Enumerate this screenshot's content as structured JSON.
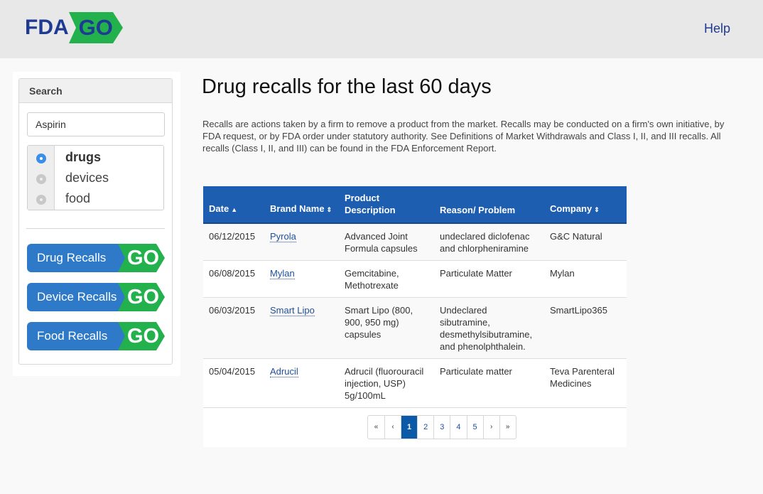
{
  "header": {
    "logo_fda": "FDA",
    "logo_go": "GO",
    "help_label": "Help"
  },
  "sidebar": {
    "panel_title": "Search",
    "search_value": "Aspirin",
    "categories": [
      {
        "label": "drugs",
        "checked": true
      },
      {
        "label": "devices",
        "checked": false
      },
      {
        "label": "food",
        "checked": false
      }
    ],
    "buttons": [
      {
        "label": "Drug Recalls",
        "go": "GO"
      },
      {
        "label": "Device Recalls",
        "go": "GO"
      },
      {
        "label": "Food Recalls",
        "go": "GO"
      }
    ]
  },
  "main": {
    "title": "Drug recalls for the last 60 days",
    "intro": "Recalls are actions taken by a firm to remove a product from the market. Recalls may be conducted on a firm's own initiative, by FDA request, or by FDA order under statutory authority. See Definitions of Market Withdrawals and Class I, II, and III recalls. All recalls (Class I, II, and III) can be found in the FDA Enforcement Report.",
    "table": {
      "columns": [
        {
          "label": "Date",
          "sort": "▲"
        },
        {
          "label": "Brand Name",
          "sort": "⇕"
        },
        {
          "label": "Product Description",
          "sort": ""
        },
        {
          "label": "Reason/ Problem",
          "sort": ""
        },
        {
          "label": "Company",
          "sort": "⇕"
        }
      ],
      "rows": [
        {
          "date": "06/12/2015",
          "brand": "Pyrola",
          "product": "Advanced Joint Formula capsules",
          "reason": "undeclared diclofenac and chlorpheniramine",
          "company": "G&C Natural"
        },
        {
          "date": "06/08/2015",
          "brand": "Mylan",
          "product": "Gemcitabine, Methotrexate",
          "reason": "Particulate Matter",
          "company": "Mylan"
        },
        {
          "date": "06/03/2015",
          "brand": "Smart Lipo",
          "product": "Smart Lipo (800, 900, 950 mg) capsules",
          "reason": "Undeclared sibutramine, desmethylsibutramine, and phenolphthalein.",
          "company": "SmartLipo365"
        },
        {
          "date": "05/04/2015",
          "brand": "Adrucil",
          "product": "Adrucil (fluorouracil injection, USP) 5g/100mL",
          "reason": "Particulate matter",
          "company": "Teva Parenteral Medicines"
        }
      ]
    },
    "pagination": {
      "first": "«",
      "prev": "‹",
      "pages": [
        "1",
        "2",
        "3",
        "4",
        "5"
      ],
      "current": "1",
      "next": "›",
      "last": "»"
    }
  },
  "colors": {
    "brand_blue": "#1f3a93",
    "go_green": "#22b14c",
    "button_blue": "#2f7ac8",
    "table_header": "#1e5eb0",
    "radio_checked": "#3b8eea"
  }
}
